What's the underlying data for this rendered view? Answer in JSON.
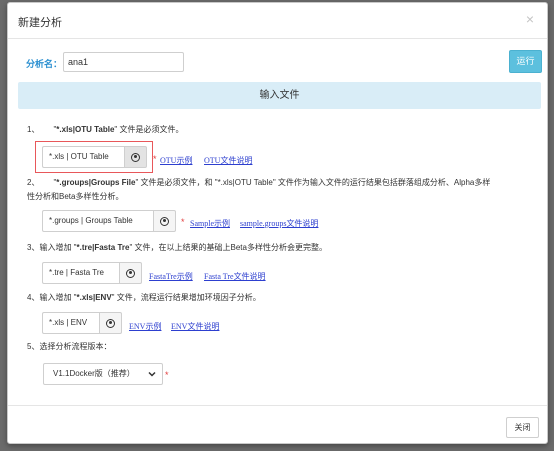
{
  "dialog": {
    "title": "新建分析",
    "close_symbol": "×"
  },
  "name_field": {
    "label": "分析名：",
    "value": "ana1"
  },
  "run_button": "运行",
  "input_section_title": "输入文件",
  "steps": [
    {
      "number": "1、",
      "quote_open": "\"",
      "name": "*.xls|OTU Table",
      "quote_close": "\"",
      "text": " 文件是必须文件。",
      "file_label": "*.xls | OTU Table",
      "required": "*",
      "links": [
        "OTU示例",
        "OTU文件说明"
      ]
    },
    {
      "number": "2、",
      "quote_open": "\"",
      "name": "*.groups|Groups File",
      "quote_close": "\"",
      "text_line1": " 文件是必须文件，和 \"*.xls|OTU Table\" 文件作为输入文件的运行结果包括群落组成分析、Alpha多样",
      "text_line2": "性分析和Beta多样性分析。",
      "file_label": "*.groups | Groups Table",
      "required": "*",
      "links": [
        "Sample示例",
        "sample.groups文件说明"
      ]
    },
    {
      "number": "3、",
      "prefix": "输入增加 \"",
      "name": "*.tre|Fasta Tre",
      "suffix": "\" 文件，在以上结果的基础上Beta多样性分析会更完整。",
      "file_label": "*.tre | Fasta Tre",
      "links": [
        "FastaTre示例",
        "Fasta Tre文件说明"
      ]
    },
    {
      "number": "4、",
      "prefix": "输入增加 \"",
      "name": "*.xls|ENV",
      "suffix": "\" 文件，流程运行结果增加环境因子分析。",
      "file_label": "*.xls | ENV",
      "links": [
        "ENV示例",
        "ENV文件说明"
      ]
    },
    {
      "number": "5、",
      "text": "选择分析流程版本：",
      "select_value": "V1.1Docker版（推荐）",
      "required": "*"
    }
  ],
  "footer": {
    "close_button": "关闭"
  },
  "icons": {
    "file_select": "circle-dot-icon",
    "dropdown": "chevron-down-icon"
  },
  "colors": {
    "accent_blue": "#2a8fd0",
    "run_button": "#5cc0de",
    "section_bar": "#d9edf7",
    "required_red": "#e23c3c",
    "highlight_border": "#e8575a",
    "link": "#2d3fcf"
  }
}
